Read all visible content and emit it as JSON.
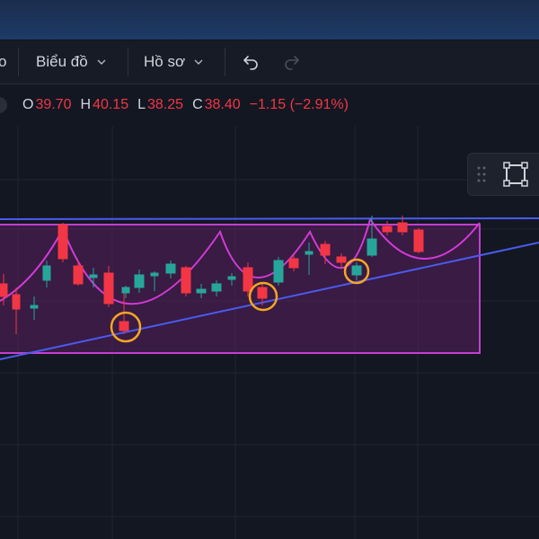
{
  "toolbar": {
    "left_fragment": "o",
    "chart_menu_label": "Biểu đồ",
    "profile_menu_label": "Hồ sơ",
    "undo_icon": "undo-icon",
    "redo_icon": "redo-icon"
  },
  "ohlc": {
    "o_label": "O",
    "o_value": "39.70",
    "h_label": "H",
    "h_value": "40.15",
    "l_label": "L",
    "l_value": "38.25",
    "c_label": "C",
    "c_value": "38.40",
    "change": "−1.15 (−2.91%)"
  },
  "floating_toolbar": {
    "drag_icon": "drag-handle-icon",
    "tool_icon": "rectangle-select-icon"
  },
  "colors": {
    "background": "#131722",
    "up": "#26a69a",
    "down": "#f23645",
    "trendline": "#3d5afe",
    "pattern": "#e040fb",
    "marker": "#f5a623",
    "text": "#d1d4dc"
  }
}
